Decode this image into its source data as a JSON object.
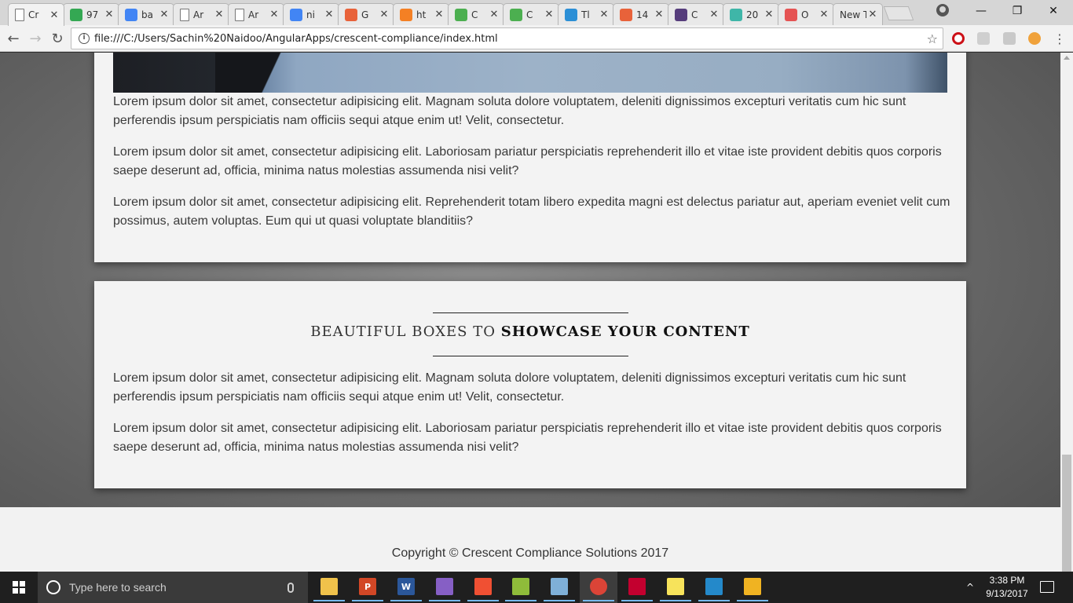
{
  "browser": {
    "tabs": [
      {
        "title": "Cr",
        "icon": "page-icon",
        "color": "#ffffff",
        "active": true
      },
      {
        "title": "97",
        "icon": "maps-icon",
        "color": "#34a853"
      },
      {
        "title": "ba",
        "icon": "google-icon",
        "color": "#4285f4"
      },
      {
        "title": "Ar",
        "icon": "page-icon",
        "color": "#ffffff"
      },
      {
        "title": "Ar",
        "icon": "page-icon",
        "color": "#ffffff"
      },
      {
        "title": "ni",
        "icon": "google-icon",
        "color": "#4285f4"
      },
      {
        "title": "G",
        "icon": "html5-icon",
        "color": "#e8623a"
      },
      {
        "title": "ht",
        "icon": "stackoverflow-icon",
        "color": "#f48024"
      },
      {
        "title": "C",
        "icon": "w3schools-icon",
        "color": "#4caf50"
      },
      {
        "title": "C",
        "icon": "w3schools-icon",
        "color": "#4caf50"
      },
      {
        "title": "Tl",
        "icon": "sitepoint-icon",
        "color": "#2b8fd6"
      },
      {
        "title": "14",
        "icon": "html5-icon",
        "color": "#e8623a"
      },
      {
        "title": "C",
        "icon": "bootstrap-icon",
        "color": "#563d7c"
      },
      {
        "title": "20",
        "icon": "teal-square-icon",
        "color": "#3fb6a8"
      },
      {
        "title": "O",
        "icon": "f-icon",
        "color": "#e55353"
      },
      {
        "title": "New T",
        "icon": "none",
        "color": "#e9e9e9"
      }
    ],
    "url": "file:///C:/Users/Sachin%20Naidoo/AngularApps/crescent-compliance/index.html",
    "window_controls": {
      "minimize": "—",
      "restore": "❐",
      "close": "✕"
    }
  },
  "page": {
    "card1": {
      "paragraphs": [
        "Lorem ipsum dolor sit amet, consectetur adipisicing elit. Magnam soluta dolore voluptatem, deleniti dignissimos excepturi veritatis cum hic sunt perferendis ipsum perspiciatis nam officiis sequi atque enim ut! Velit, consectetur.",
        "Lorem ipsum dolor sit amet, consectetur adipisicing elit. Laboriosam pariatur perspiciatis reprehenderit illo et vitae iste provident debitis quos corporis saepe deserunt ad, officia, minima natus molestias assumenda nisi velit?",
        "Lorem ipsum dolor sit amet, consectetur adipisicing elit. Reprehenderit totam libero expedita magni est delectus pariatur aut, aperiam eveniet velit cum possimus, autem voluptas. Eum qui ut quasi voluptate blanditiis?"
      ]
    },
    "card2": {
      "heading_light": "Beautiful boxes to ",
      "heading_bold": "showcase your content",
      "paragraphs": [
        "Lorem ipsum dolor sit amet, consectetur adipisicing elit. Magnam soluta dolore voluptatem, deleniti dignissimos excepturi veritatis cum hic sunt perferendis ipsum perspiciatis nam officiis sequi atque enim ut! Velit, consectetur.",
        "Lorem ipsum dolor sit amet, consectetur adipisicing elit. Laboriosam pariatur perspiciatis reprehenderit illo et vitae iste provident debitis quos corporis saepe deserunt ad, officia, minima natus molestias assumenda nisi velit?"
      ]
    },
    "footer": {
      "copyright": "Copyright © Crescent Compliance Solutions 2017"
    }
  },
  "taskbar": {
    "search_placeholder": "Type here to search",
    "apps": [
      {
        "name": "file-explorer-icon",
        "label": "",
        "color": "#f0c24b"
      },
      {
        "name": "powerpoint-icon",
        "label": "P",
        "color": "#d24726"
      },
      {
        "name": "word-icon",
        "label": "W",
        "color": "#2b579a"
      },
      {
        "name": "visual-studio-icon",
        "label": "",
        "color": "#865fc5"
      },
      {
        "name": "git-icon",
        "label": "",
        "color": "#f05033"
      },
      {
        "name": "tools-icon",
        "label": "",
        "color": "#8fbc3a"
      },
      {
        "name": "app-icon",
        "label": "",
        "color": "#7fb0d8"
      },
      {
        "name": "chrome-icon",
        "label": "",
        "color": "#db4437"
      },
      {
        "name": "angular-cli-icon",
        "label": "",
        "color": "#c3002f"
      },
      {
        "name": "sticky-notes-icon",
        "label": "",
        "color": "#f7e35b"
      },
      {
        "name": "vscode-icon",
        "label": "",
        "color": "#2489ca"
      },
      {
        "name": "windows-server-icon",
        "label": "",
        "color": "#f0b322"
      }
    ],
    "clock_time": "3:38 PM",
    "clock_date": "9/13/2017"
  }
}
